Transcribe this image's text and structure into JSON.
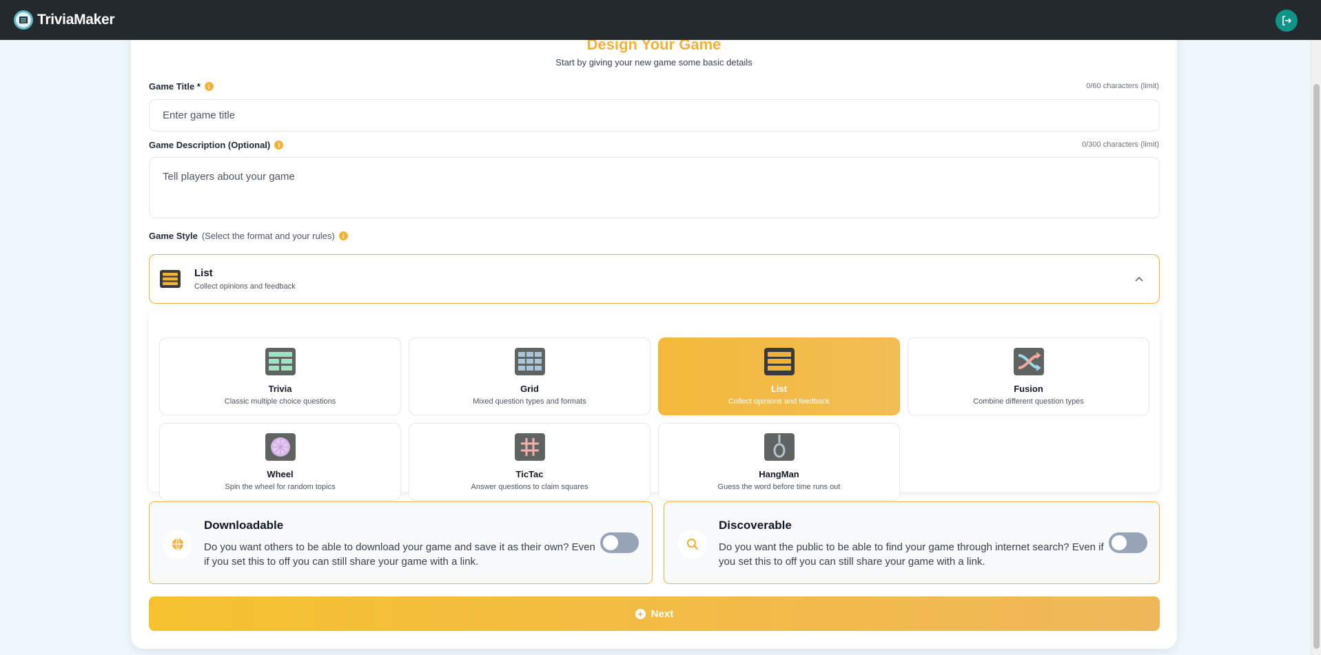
{
  "app": {
    "name": "TriviaMaker",
    "logout_icon": "logout-icon",
    "colors": {
      "accent": "#f2b23a",
      "teal": "#0f9488",
      "topbar": "#24292e"
    }
  },
  "header": {
    "title": "Design Your Game",
    "subtitle": "Start by giving your new game some basic details"
  },
  "form": {
    "title": {
      "label": "Game Title *",
      "limit": "0/60 characters (limit)",
      "value": "",
      "placeholder": "Enter game title"
    },
    "description": {
      "label": "Game Description (Optional)",
      "limit": "0/300 characters (limit)",
      "value": "",
      "placeholder": "Tell players about your game"
    },
    "style": {
      "label": "Game Style",
      "hint": "(Select the format and your rules)",
      "selected": {
        "name": "List",
        "description": "Collect opinions and feedback"
      },
      "options": [
        {
          "name": "Trivia",
          "description": "Classic multiple choice questions",
          "icon": "trivia-icon"
        },
        {
          "name": "Grid",
          "description": "Mixed question types and formats",
          "icon": "grid-icon"
        },
        {
          "name": "List",
          "description": "Collect opinions and feedback",
          "icon": "list-icon",
          "selected": true
        },
        {
          "name": "Fusion",
          "description": "Combine different question types",
          "icon": "fusion-icon"
        },
        {
          "name": "Wheel",
          "description": "Spin the wheel for random topics",
          "icon": "wheel-icon"
        },
        {
          "name": "TicTac",
          "description": "Answer questions to claim squares",
          "icon": "tictac-icon"
        },
        {
          "name": "HangMan",
          "description": "Guess the word before time runs out",
          "icon": "hangman-icon"
        }
      ]
    }
  },
  "settings": {
    "downloadable": {
      "title": "Downloadable",
      "description": "Do you want others to be able to download your game and save it as their own? Even if you set this to off you can still share your game with a link.",
      "enabled": false,
      "icon": "globe-icon"
    },
    "discoverable": {
      "title": "Discoverable",
      "description": "Do you want the public to be able to find your game through internet search? Even if you set this to off you can still share your game with a link.",
      "enabled": false,
      "icon": "search-icon"
    }
  },
  "actions": {
    "next_label": "Next"
  }
}
